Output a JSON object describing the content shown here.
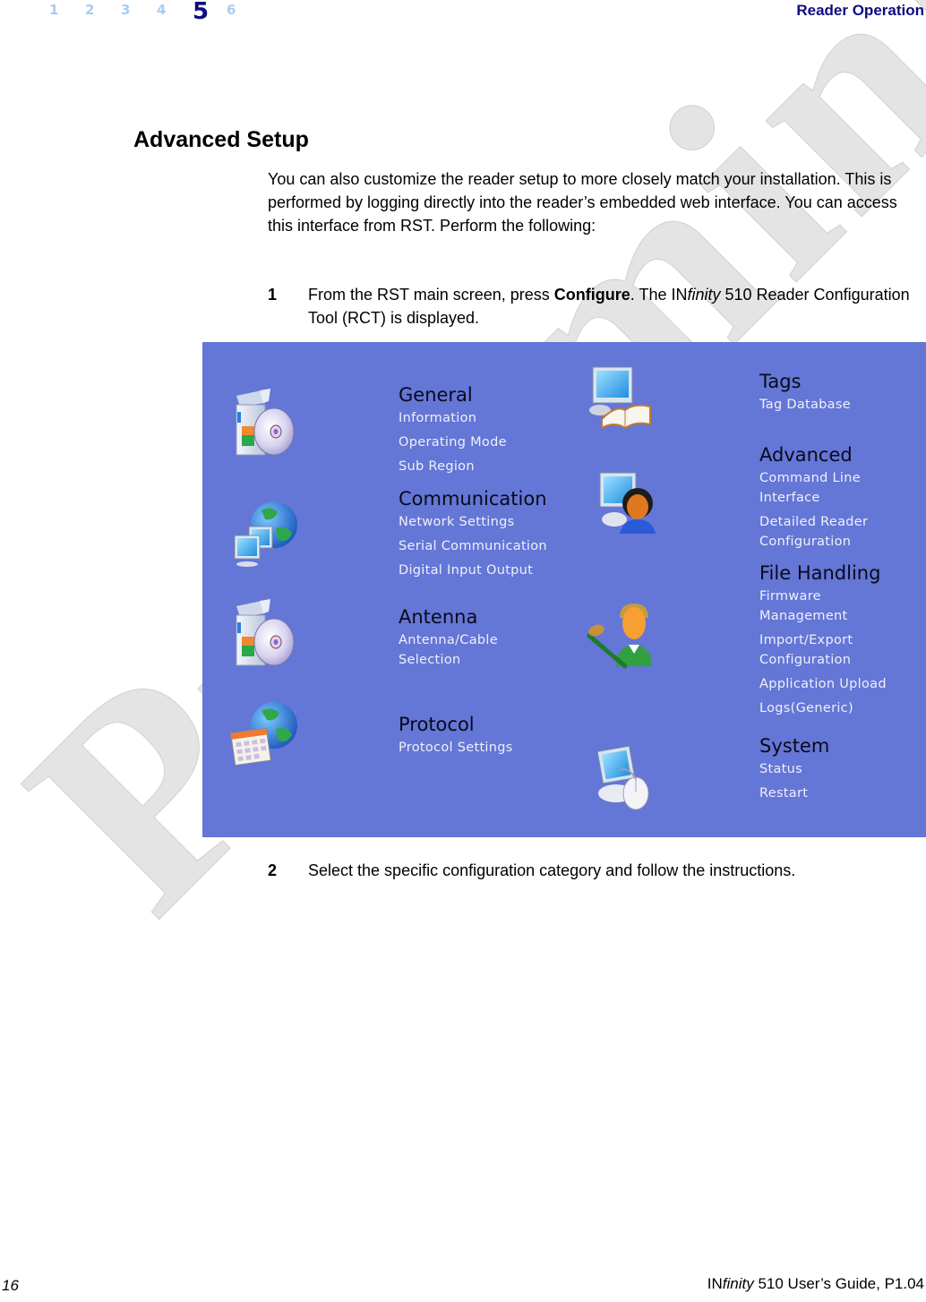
{
  "header": {
    "chapters": [
      "1",
      "2",
      "3",
      "4",
      "5",
      "6"
    ],
    "active_chapter": "5",
    "section_name": "Reader Operation"
  },
  "watermark": "Preliminary",
  "content": {
    "title": "Advanced Setup",
    "intro": "You can also customize the reader setup to more closely match your installation. This is performed by logging directly into the reader’s embedded web interface. You can access this interface from RST. Perform the following:",
    "steps": [
      {
        "number": "1",
        "text_before": "From the RST main screen, press ",
        "bold": "Configure",
        "text_middle": ". The IN",
        "italic": "finity",
        "text_after": " 510 Reader Configuration Tool (RCT) is displayed."
      },
      {
        "number": "2",
        "text": "Select the specific configuration category and follow the instructions."
      }
    ]
  },
  "rct": {
    "background": "#6476d6",
    "left_groups": [
      {
        "title": "General",
        "icon": "software-box-cd-icon",
        "items": [
          "Information",
          "Operating Mode",
          "Sub Region"
        ]
      },
      {
        "title": "Communication",
        "icon": "network-globe-computers-icon",
        "items": [
          "Network Settings",
          "Serial Communication",
          "Digital Input Output"
        ]
      },
      {
        "title": "Antenna",
        "icon": "software-box-cd-icon",
        "items": [
          "Antenna/Cable Selection"
        ]
      },
      {
        "title": "Protocol",
        "icon": "globe-calendar-icon",
        "items": [
          "Protocol Settings"
        ]
      }
    ],
    "right_groups": [
      {
        "title": "Tags",
        "icon": "computer-book-icon",
        "items": [
          "Tag Database"
        ]
      },
      {
        "title": "Advanced",
        "icon": "computer-user-icon",
        "items": [
          "Command Line Interface",
          "Detailed Reader Configuration"
        ]
      },
      {
        "title": "File Handling",
        "icon": "user-edit-icon",
        "items": [
          "Firmware Management",
          "Import/Export Configuration",
          "Application Upload",
          "Logs(Generic)"
        ]
      },
      {
        "title": "System",
        "icon": "computer-mouse-icon",
        "items": [
          "Status",
          "Restart"
        ]
      }
    ]
  },
  "footer": {
    "page_number": "16",
    "doc_brand_prefix": "IN",
    "doc_brand_italic": "finity",
    "doc_title_rest": " 510 User’s Guide, P1.04"
  }
}
